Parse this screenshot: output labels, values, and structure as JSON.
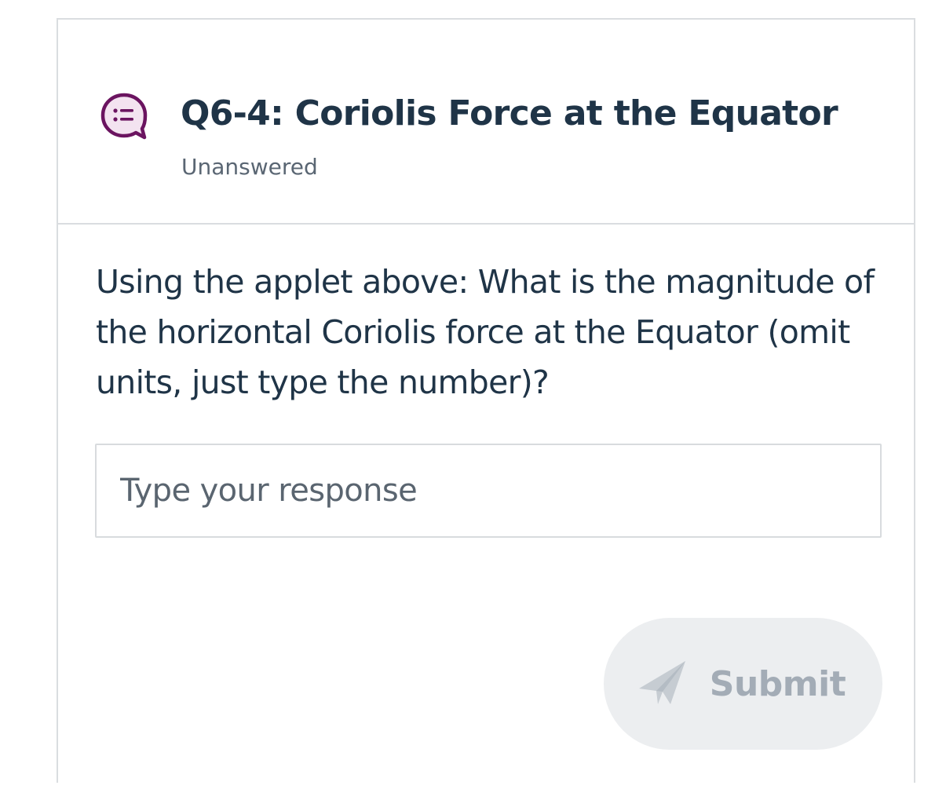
{
  "question": {
    "icon": "multiple-choice-chat-bubble-icon",
    "title": "Q6-4: Coriolis Force at the Equator",
    "status": "Unanswered",
    "prompt": "Using the applet above: What is the magnitude of the horizontal Coriolis force at the Equator (omit units, just type the number)?"
  },
  "response": {
    "value": "",
    "placeholder": "Type your response"
  },
  "submit": {
    "label": "Submit",
    "icon": "paper-plane-icon",
    "state": "disabled"
  },
  "colors": {
    "icon_accent": "#6b1460",
    "icon_fill": "#f3e3f0",
    "text_primary": "#1f3447",
    "text_secondary": "#5a6673",
    "border": "#dadde0",
    "button_bg_disabled": "#eceef0",
    "button_text_disabled": "#a3acb6"
  }
}
